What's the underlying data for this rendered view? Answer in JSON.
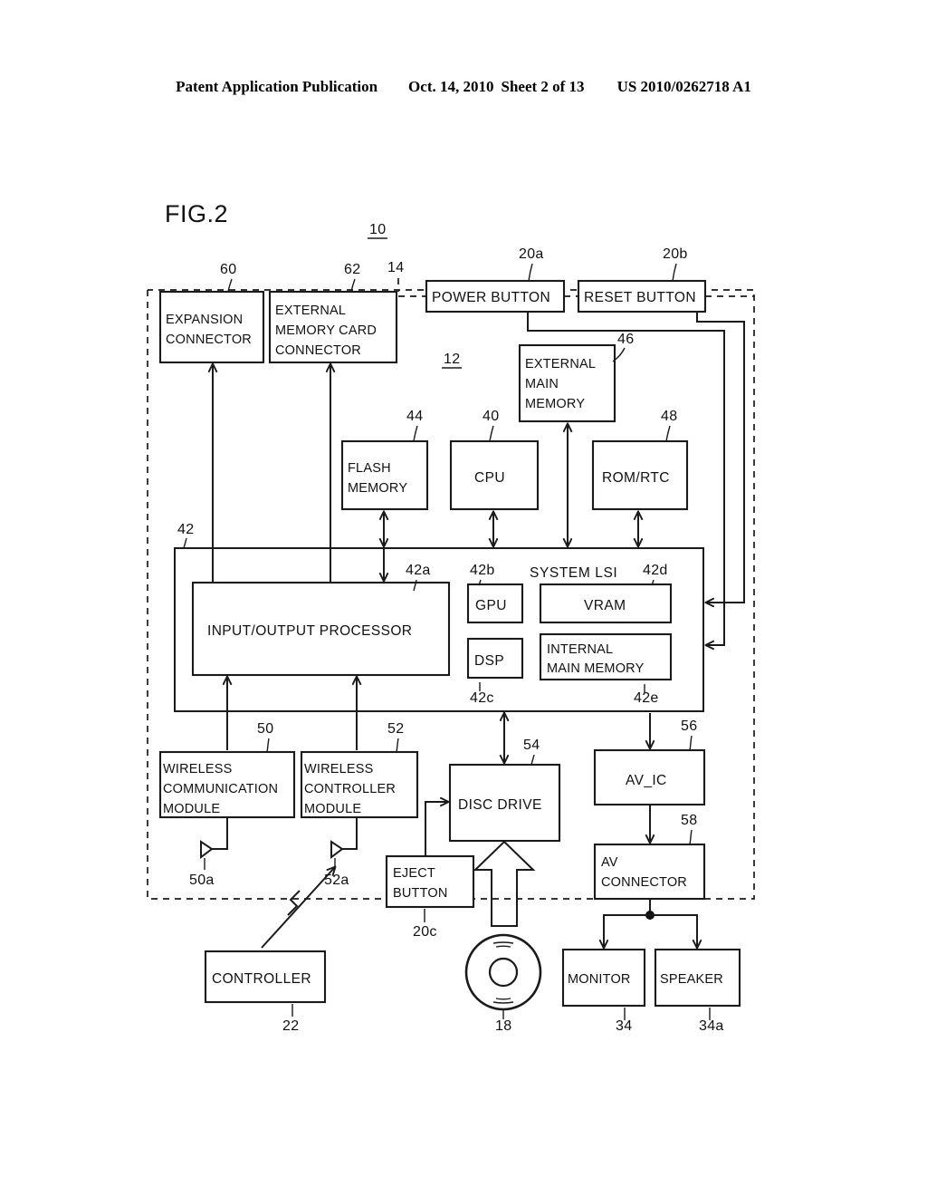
{
  "header": {
    "publication": "Patent Application Publication",
    "date": "Oct. 14, 2010",
    "sheet": "Sheet 2 of 13",
    "patent_number": "US 2010/0262718 A1"
  },
  "figure": {
    "label": "FIG.2",
    "system_ref": "10",
    "inner_ref": "12",
    "lsi_title": "SYSTEM LSI"
  },
  "boxes": {
    "expansion_connector": {
      "label_line1": "EXPANSION",
      "label_line2": "CONNECTOR",
      "ref": "60"
    },
    "external_memory_card_connector": {
      "label_line1": "EXTERNAL",
      "label_line2": "MEMORY CARD",
      "label_line3": "CONNECTOR",
      "ref": "62"
    },
    "power_button": {
      "label": "POWER BUTTON",
      "ref": "20a"
    },
    "reset_button": {
      "label": "RESET BUTTON",
      "ref": "20b"
    },
    "external_main_memory": {
      "label_line1": "EXTERNAL",
      "label_line2": "MAIN",
      "label_line3": "MEMORY",
      "ref": "46"
    },
    "flash_memory": {
      "label_line1": "FLASH",
      "label_line2": "MEMORY",
      "ref": "44"
    },
    "cpu": {
      "label": "CPU",
      "ref": "40"
    },
    "rom_rtc": {
      "label": "ROM/RTC",
      "ref": "48"
    },
    "system_lsi": {
      "label": "SYSTEM LSI",
      "ref": "42"
    },
    "input_output_processor": {
      "label": "INPUT/OUTPUT PROCESSOR",
      "ref": "42a"
    },
    "gpu": {
      "label": "GPU",
      "ref": "42b"
    },
    "vram": {
      "label": "VRAM",
      "ref": "42d"
    },
    "dsp": {
      "label": "DSP",
      "ref": "42c"
    },
    "internal_main_memory": {
      "label_line1": "INTERNAL",
      "label_line2": "MAIN MEMORY",
      "ref": "42e"
    },
    "wireless_communication_module": {
      "label_line1": "WIRELESS",
      "label_line2": "COMMUNICATION",
      "label_line3": "MODULE",
      "ref": "50",
      "antenna_ref": "50a"
    },
    "wireless_controller_module": {
      "label_line1": "WIRELESS",
      "label_line2": "CONTROLLER",
      "label_line3": "MODULE",
      "ref": "52",
      "antenna_ref": "52a"
    },
    "disc_drive": {
      "label": "DISC DRIVE",
      "ref": "54"
    },
    "eject_button": {
      "label_line1": "EJECT",
      "label_line2": "BUTTON",
      "ref": "20c"
    },
    "av_ic": {
      "label": "AV_IC",
      "ref": "56"
    },
    "av_connector": {
      "label_line1": "AV",
      "label_line2": "CONNECTOR",
      "ref": "58"
    },
    "controller": {
      "label": "CONTROLLER",
      "ref": "22"
    },
    "optical_disc": {
      "ref": "18"
    },
    "monitor": {
      "label": "MONITOR",
      "ref": "34"
    },
    "speaker": {
      "label": "SPEAKER",
      "ref": "34a"
    },
    "housing_ref": {
      "ref": "14"
    }
  },
  "colors": {
    "ink": "#1a1a1a",
    "paper": "#ffffff"
  }
}
